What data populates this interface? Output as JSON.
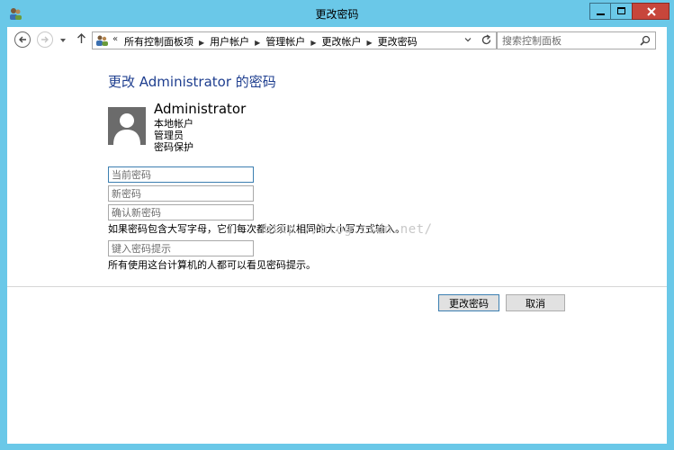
{
  "window": {
    "title": "更改密码"
  },
  "address": {
    "overflow_glyph": "«",
    "crumbs": [
      "所有控制面板项",
      "用户帐户",
      "管理帐户",
      "更改帐户",
      "更改密码"
    ]
  },
  "search": {
    "placeholder": "搜索控制面板"
  },
  "main": {
    "heading": "更改 Administrator 的密码",
    "account": {
      "name": "Administrator",
      "type": "本地帐户",
      "role": "管理员",
      "status": "密码保护"
    },
    "fields": {
      "current_placeholder": "当前密码",
      "new_placeholder": "新密码",
      "confirm_placeholder": "确认新密码",
      "hint_placeholder": "键入密码提示"
    },
    "case_note": "如果密码包含大写字母，它们每次都必须以相同的大小写方式输入。",
    "hint_note": "所有使用这台计算机的人都可以看见密码提示。",
    "watermark": "http://blog.csdn.net/"
  },
  "buttons": {
    "change": "更改密码",
    "cancel": "取消"
  },
  "colors": {
    "frame": "#6ac8e8",
    "close": "#c7463b",
    "heading": "#1e3e8f"
  }
}
